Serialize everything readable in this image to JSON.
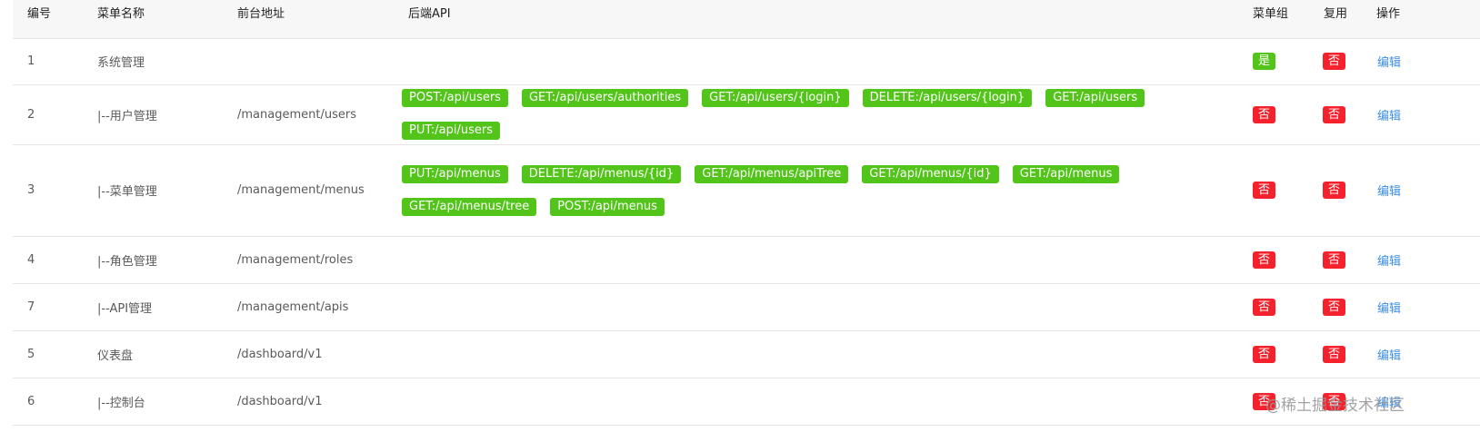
{
  "columns": {
    "id": "编号",
    "name": "菜单名称",
    "path": "前台地址",
    "api": "后端API",
    "group": "菜单组",
    "reuse": "复用",
    "ops": "操作"
  },
  "rows": [
    {
      "id": "1",
      "name": "系统管理",
      "path": "",
      "apis": [],
      "group": "是",
      "reuse": "否",
      "action": "编辑"
    },
    {
      "id": "2",
      "name": "|--用户管理",
      "path": "/management/users",
      "apis": [
        "POST:/api/users",
        "GET:/api/users/authorities",
        "GET:/api/users/{login}",
        "DELETE:/api/users/{login}",
        "GET:/api/users",
        "PUT:/api/users"
      ],
      "group": "否",
      "reuse": "否",
      "action": "编辑"
    },
    {
      "id": "3",
      "name": "|--菜单管理",
      "path": "/management/menus",
      "apis": [
        "PUT:/api/menus",
        "DELETE:/api/menus/{id}",
        "GET:/api/menus/apiTree",
        "GET:/api/menus/{id}",
        "GET:/api/menus",
        "GET:/api/menus/tree",
        "POST:/api/menus"
      ],
      "group": "否",
      "reuse": "否",
      "action": "编辑"
    },
    {
      "id": "4",
      "name": "|--角色管理",
      "path": "/management/roles",
      "apis": [],
      "group": "否",
      "reuse": "否",
      "action": "编辑"
    },
    {
      "id": "7",
      "name": "|--API管理",
      "path": "/management/apis",
      "apis": [],
      "group": "否",
      "reuse": "否",
      "action": "编辑"
    },
    {
      "id": "5",
      "name": "仪表盘",
      "path": "/dashboard/v1",
      "apis": [],
      "group": "否",
      "reuse": "否",
      "action": "编辑"
    },
    {
      "id": "6",
      "name": "|--控制台",
      "path": "/dashboard/v1",
      "apis": [],
      "group": "否",
      "reuse": "否",
      "action": "编辑"
    }
  ],
  "watermark": "@稀土掘金技术社区",
  "colors": {
    "yes_badge": "#52c41a",
    "no_badge": "#f5222d",
    "api_tag": "#52c41a",
    "link": "#3a8ee6",
    "header_bg": "#f7f7f7"
  }
}
